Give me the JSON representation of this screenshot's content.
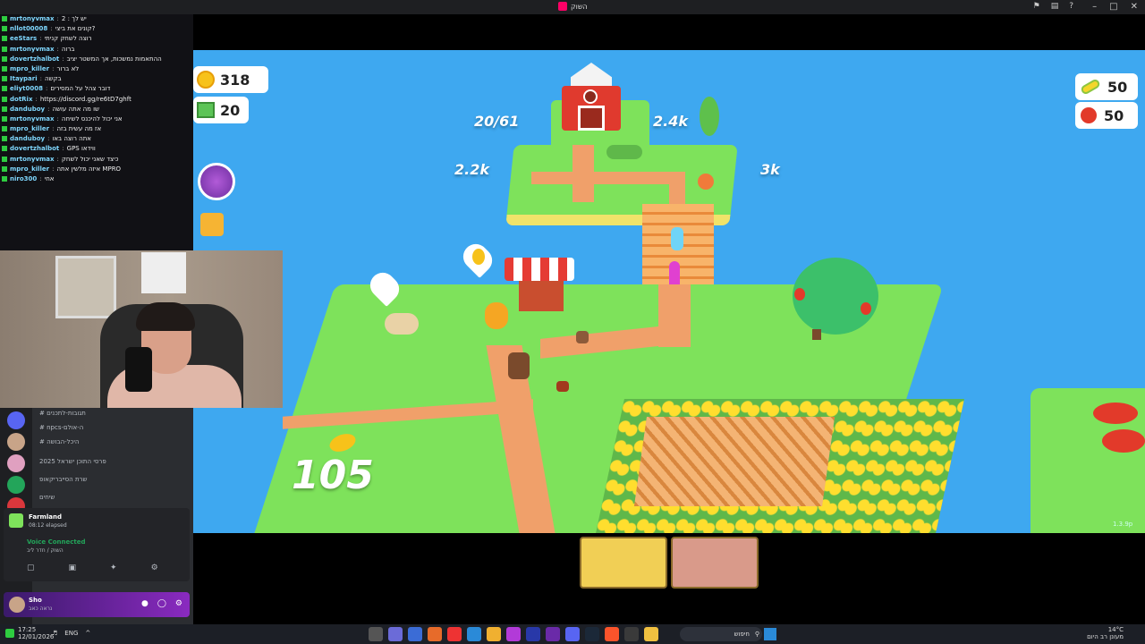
{
  "window": {
    "title": "השוק"
  },
  "hud": {
    "coins": "318",
    "blocks": "20",
    "corn": "50",
    "tomatoes": "50",
    "coin_float": "105",
    "version": "1.3.9p"
  },
  "map_labels": {
    "barn_capacity": "20/61",
    "price_a": "2.4k",
    "price_b": "2.2k",
    "price_c": "3k"
  },
  "chat": [
    {
      "user": "mrtonyvmax",
      "msg": "יש לך : 2"
    },
    {
      "user": "nllot00008",
      "msg": "קונים את ביצי?"
    },
    {
      "user": "eeStars",
      "msg": "רוצה לשחק קניתי"
    },
    {
      "user": "mrtonyvmax",
      "msg": "ברוה"
    },
    {
      "user": "dovertzhalbot",
      "msg": "ההתאמות נמשכות, אך המשטר יציב"
    },
    {
      "user": "mpro_killer",
      "msg": "לא ברור"
    },
    {
      "user": "Itaypari",
      "msg": "בקשה"
    },
    {
      "user": "eliyt0008",
      "msg": "דובר צהל על המסירים"
    },
    {
      "user": "dotRix",
      "msg": "https://discord.gg/re6tD7ghft"
    },
    {
      "user": "danduboy",
      "msg": "שו מה אתה עושה"
    },
    {
      "user": "mrtonyvmax",
      "msg": "אני יכול להיכנס לשיחה"
    },
    {
      "user": "mpro_killer",
      "msg": "אז מה עשית בזה"
    },
    {
      "user": "danduboy",
      "msg": "אתה רוצה באו"
    },
    {
      "user": "dovertzhalbot",
      "msg": "GPS ווידאו"
    },
    {
      "user": "mrtonyvmax",
      "msg": "כיצד שאני יכול לשחק"
    },
    {
      "user": "mpro_killer",
      "msg": "איזה מלשין אתה MPRO"
    },
    {
      "user": "niro300",
      "msg": "אחי"
    }
  ],
  "discord": {
    "channels": [
      "תגובות-לתכנים",
      "npcs-ה-אולם",
      "היכל-הבושה",
      "פרסי התוכן ישראל 2025",
      "שרת הסייבריקאופ",
      "שיחים"
    ],
    "activity_title": "Farmland",
    "activity_sub": "08:12 elapsed",
    "voice_status": "Voice Connected",
    "voice_channel": "השוק / חדר ליב",
    "user_name": "Sho",
    "user_status": "נראה כאב"
  },
  "taskbar": {
    "time": "17:25",
    "date": "12/01/2026",
    "lang": "ENG",
    "search_label": "חיפוש",
    "weather_temp": "14°C",
    "weather_desc": "מעונן רב היום"
  },
  "colors": {
    "water": "#3ea8f0",
    "grass": "#7ee25b",
    "sand": "#f0e36a",
    "path": "#f0a06a",
    "coin": "#f7c21a"
  }
}
